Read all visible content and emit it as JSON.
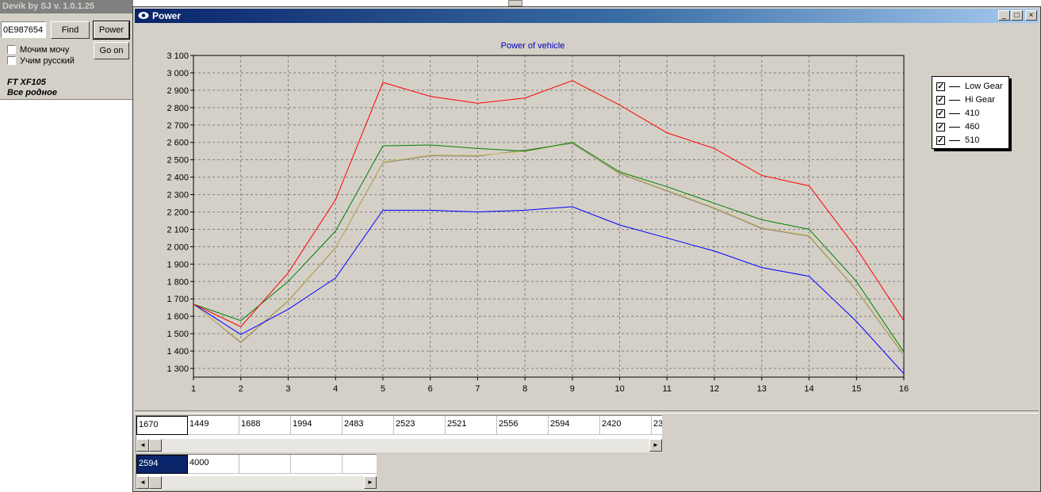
{
  "app": {
    "title": "Devik by SJ v. 1.0.1.25",
    "search_value": "0E987654",
    "find_label": "Find",
    "power_label": "Power",
    "go_on_label": "Go on",
    "checkbox1_label": "Мочим мочу",
    "checkbox2_label": "Учим русский",
    "info_line1": "FT XF105",
    "info_line2": "Все родное"
  },
  "window": {
    "title": "Power",
    "min_glyph": "_",
    "max_glyph": "□",
    "close_glyph": "×"
  },
  "grid1": {
    "cells": [
      "1670",
      "1449",
      "1688",
      "1994",
      "2483",
      "2523",
      "2521",
      "2556",
      "2594",
      "2420",
      "23"
    ]
  },
  "grid2": {
    "cells": [
      "2594",
      "4000",
      "",
      "",
      ""
    ]
  },
  "scroll": {
    "left_glyph": "◄",
    "right_glyph": "►"
  },
  "colors": {
    "low_gear": "#808080",
    "hi_gear": "#d4c060",
    "s410": "#0000ff",
    "s460": "#008000",
    "s510": "#ff0000",
    "title_blue": "#0000c0",
    "legend_line": "#000000"
  },
  "chart_data": {
    "type": "line",
    "title": "Power of vehicle",
    "xlabel": "",
    "ylabel": "",
    "x": [
      1,
      2,
      3,
      4,
      5,
      6,
      7,
      8,
      9,
      10,
      11,
      12,
      13,
      14,
      15,
      16
    ],
    "ylim": [
      1250,
      3100
    ],
    "yticks": [
      1300,
      1400,
      1500,
      1600,
      1700,
      1800,
      1900,
      2000,
      2100,
      2200,
      2300,
      2400,
      2500,
      2600,
      2700,
      2800,
      2900,
      3000,
      3100
    ],
    "ytick_labels": [
      "1 300",
      "1 400",
      "1 500",
      "1 600",
      "1 700",
      "1 800",
      "1 900",
      "2 000",
      "2 100",
      "2 200",
      "2 300",
      "2 400",
      "2 500",
      "2 600",
      "2 700",
      "2 800",
      "2 900",
      "3 000",
      "3 100"
    ],
    "xtick_labels": [
      "1",
      "2",
      "3",
      "4",
      "5",
      "6",
      "7",
      "8",
      "9",
      "10",
      "11",
      "12",
      "13",
      "14",
      "15",
      "16"
    ],
    "grid": true,
    "legend_position": "right",
    "series": [
      {
        "name": "Low Gear",
        "color": "#808080",
        "values": [
          1670,
          1449,
          1688,
          1994,
          2483,
          2523,
          2521,
          2556,
          2594,
          2420,
          2320,
          2220,
          2105,
          2060,
          1750,
          1375
        ]
      },
      {
        "name": "Hi Gear",
        "color": "#d4c060",
        "values": [
          1670,
          1455,
          1692,
          1998,
          2488,
          2528,
          2526,
          2548,
          2598,
          2425,
          2325,
          2225,
          2110,
          2065,
          1755,
          1380
        ]
      },
      {
        "name": "410",
        "color": "#0000ff",
        "values": [
          1670,
          1495,
          1640,
          1820,
          2210,
          2210,
          2200,
          2210,
          2230,
          2125,
          2050,
          1975,
          1880,
          1830,
          1570,
          1270
        ]
      },
      {
        "name": "460",
        "color": "#008000",
        "values": [
          1670,
          1575,
          1800,
          2090,
          2580,
          2585,
          2565,
          2550,
          2600,
          2430,
          2345,
          2250,
          2155,
          2100,
          1800,
          1395
        ]
      },
      {
        "name": "510",
        "color": "#ff0000",
        "values": [
          1670,
          1540,
          1850,
          2270,
          2945,
          2865,
          2825,
          2855,
          2955,
          2815,
          2655,
          2565,
          2410,
          2350,
          1990,
          1575
        ]
      }
    ]
  }
}
